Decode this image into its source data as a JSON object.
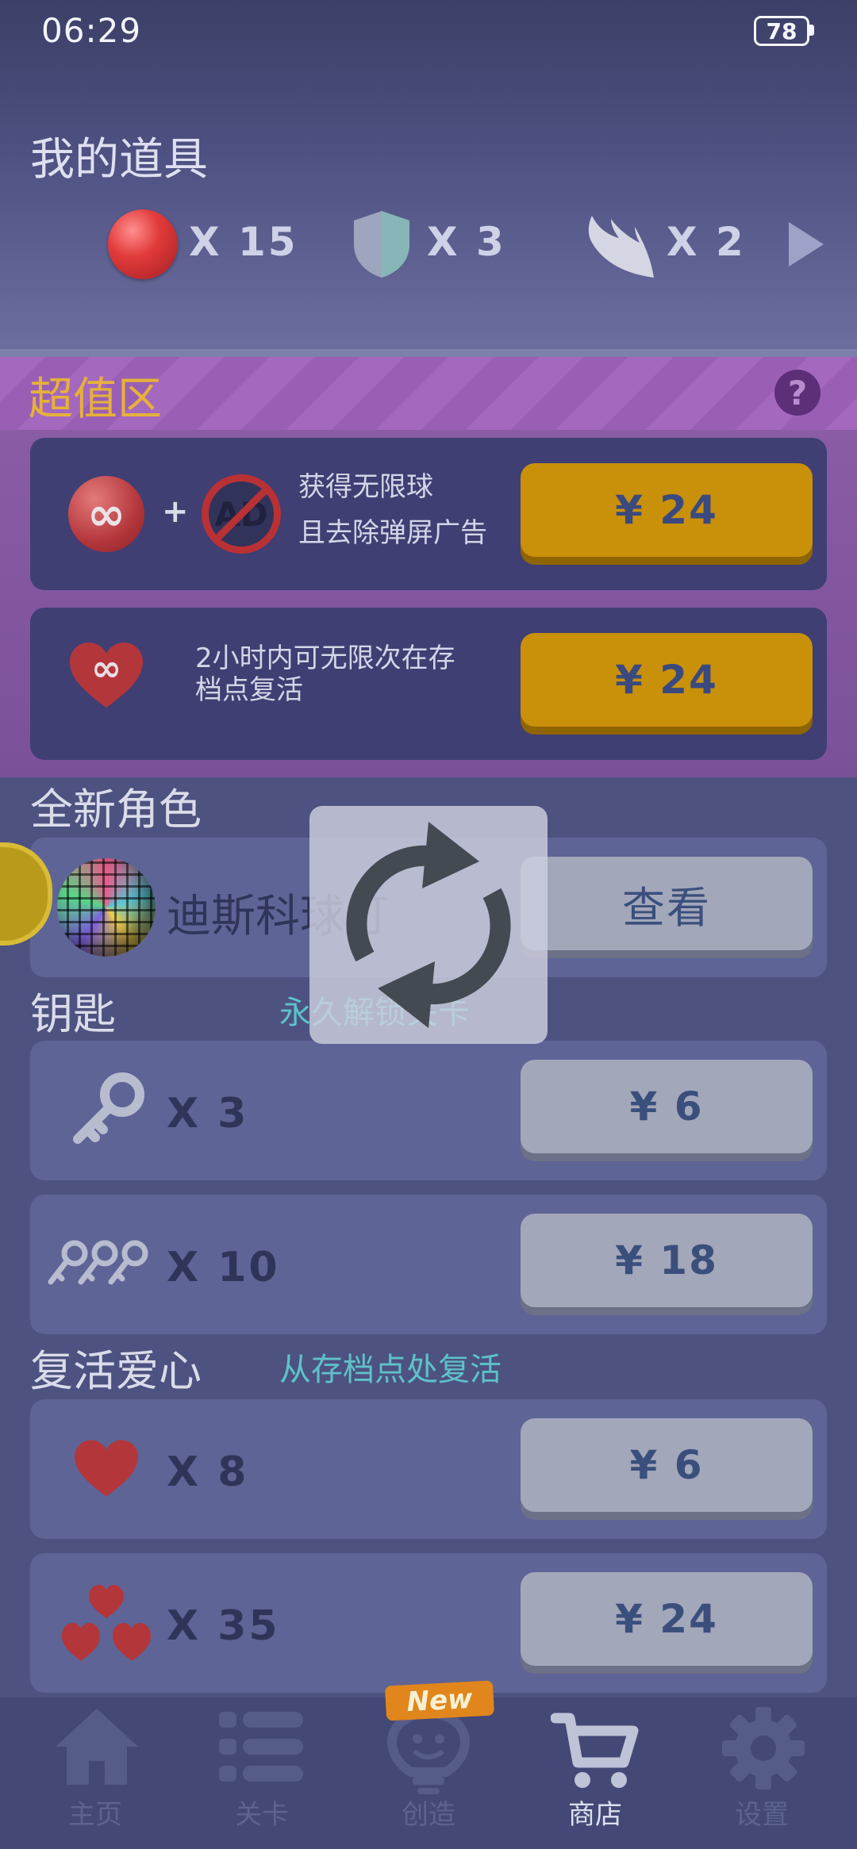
{
  "status_bar": {
    "time": "06:29",
    "battery": "78"
  },
  "my_items": {
    "title": "我的道具",
    "balls": "X 15",
    "shields": "X 3",
    "wings": "X 2"
  },
  "super_value": {
    "title": "超值区",
    "help": "?",
    "offer1": {
      "line1": "获得无限球",
      "line2": "且去除弹屏广告",
      "price": "¥ 24",
      "ad_text": "AD"
    },
    "offer2": {
      "line1": "2小时内可无限次在存",
      "line2": "档点复活",
      "price": "¥ 24"
    }
  },
  "new_character": {
    "title": "全新角色",
    "name": "迪斯科球灯",
    "button": "查看"
  },
  "keys": {
    "title": "钥匙",
    "subtitle": "永久解锁关卡",
    "pack1": {
      "count": "X 3",
      "price": "¥ 6"
    },
    "pack2": {
      "count": "X 10",
      "price": "¥ 18"
    }
  },
  "revive_hearts": {
    "title": "复活爱心",
    "subtitle": "从存档点处复活",
    "pack1": {
      "count": "X 8",
      "price": "¥ 6"
    },
    "pack2": {
      "count": "X 35",
      "price": "¥ 24"
    }
  },
  "nav": {
    "new_badge": "New",
    "items": [
      {
        "label": "主页",
        "icon": "home-icon"
      },
      {
        "label": "关卡",
        "icon": "list-icon"
      },
      {
        "label": "创造",
        "icon": "lightbulb-icon"
      },
      {
        "label": "商店",
        "icon": "cart-icon"
      },
      {
        "label": "设置",
        "icon": "gear-icon"
      }
    ],
    "active_index": 3
  },
  "colors": {
    "accent_gold": "#c9900a",
    "promo_purple": "#8d5ea8",
    "teal_text": "#5ec2c8",
    "heart_red": "#b3363b"
  }
}
